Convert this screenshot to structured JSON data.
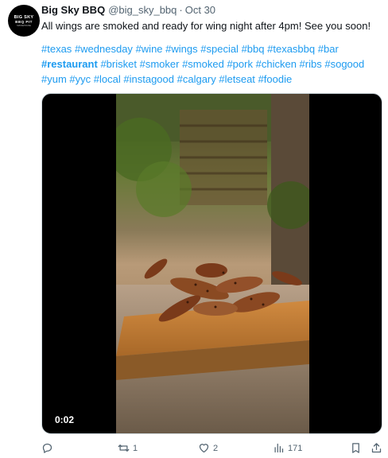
{
  "account": {
    "avatar_line1": "BIG SKY",
    "avatar_line2": "BBQ PIT",
    "avatar_line3": "SMOKEHOUSE",
    "name": "Big Sky BBQ",
    "handle": "@big_sky_bbq",
    "separator": "·",
    "date": "Oct 30"
  },
  "tweet": {
    "text": "All wings are smoked and ready for wing night after 4pm! See you soon!",
    "hashtags": [
      {
        "text": "#texas",
        "bold": false
      },
      {
        "text": "#wednesday",
        "bold": false
      },
      {
        "text": "#wine",
        "bold": false
      },
      {
        "text": "#wings",
        "bold": false
      },
      {
        "text": "#special",
        "bold": false
      },
      {
        "text": "#bbq",
        "bold": false
      },
      {
        "text": "#texasbbq",
        "bold": false
      },
      {
        "text": "#bar",
        "bold": false
      },
      {
        "text": "#restaurant",
        "bold": true
      },
      {
        "text": "#brisket",
        "bold": false
      },
      {
        "text": "#smoker",
        "bold": false
      },
      {
        "text": "#smoked",
        "bold": false
      },
      {
        "text": "#pork",
        "bold": false
      },
      {
        "text": "#chicken",
        "bold": false
      },
      {
        "text": "#ribs",
        "bold": false
      },
      {
        "text": "#sogood",
        "bold": false
      },
      {
        "text": "#yum",
        "bold": false
      },
      {
        "text": "#yyc",
        "bold": false
      },
      {
        "text": "#local",
        "bold": false
      },
      {
        "text": "#instagood",
        "bold": false
      },
      {
        "text": "#calgary",
        "bold": false
      },
      {
        "text": "#letseat",
        "bold": false
      },
      {
        "text": "#foodie",
        "bold": false
      }
    ]
  },
  "video": {
    "timestamp": "0:02"
  },
  "actions": {
    "reply_count": "",
    "retweet_count": "1",
    "like_count": "2",
    "views_count": "171"
  },
  "colors": {
    "link": "#1d9bf0",
    "muted": "#536471",
    "text": "#0f1419"
  },
  "icons": [
    "reply-icon",
    "retweet-icon",
    "like-icon",
    "views-icon",
    "bookmark-icon",
    "share-icon"
  ]
}
